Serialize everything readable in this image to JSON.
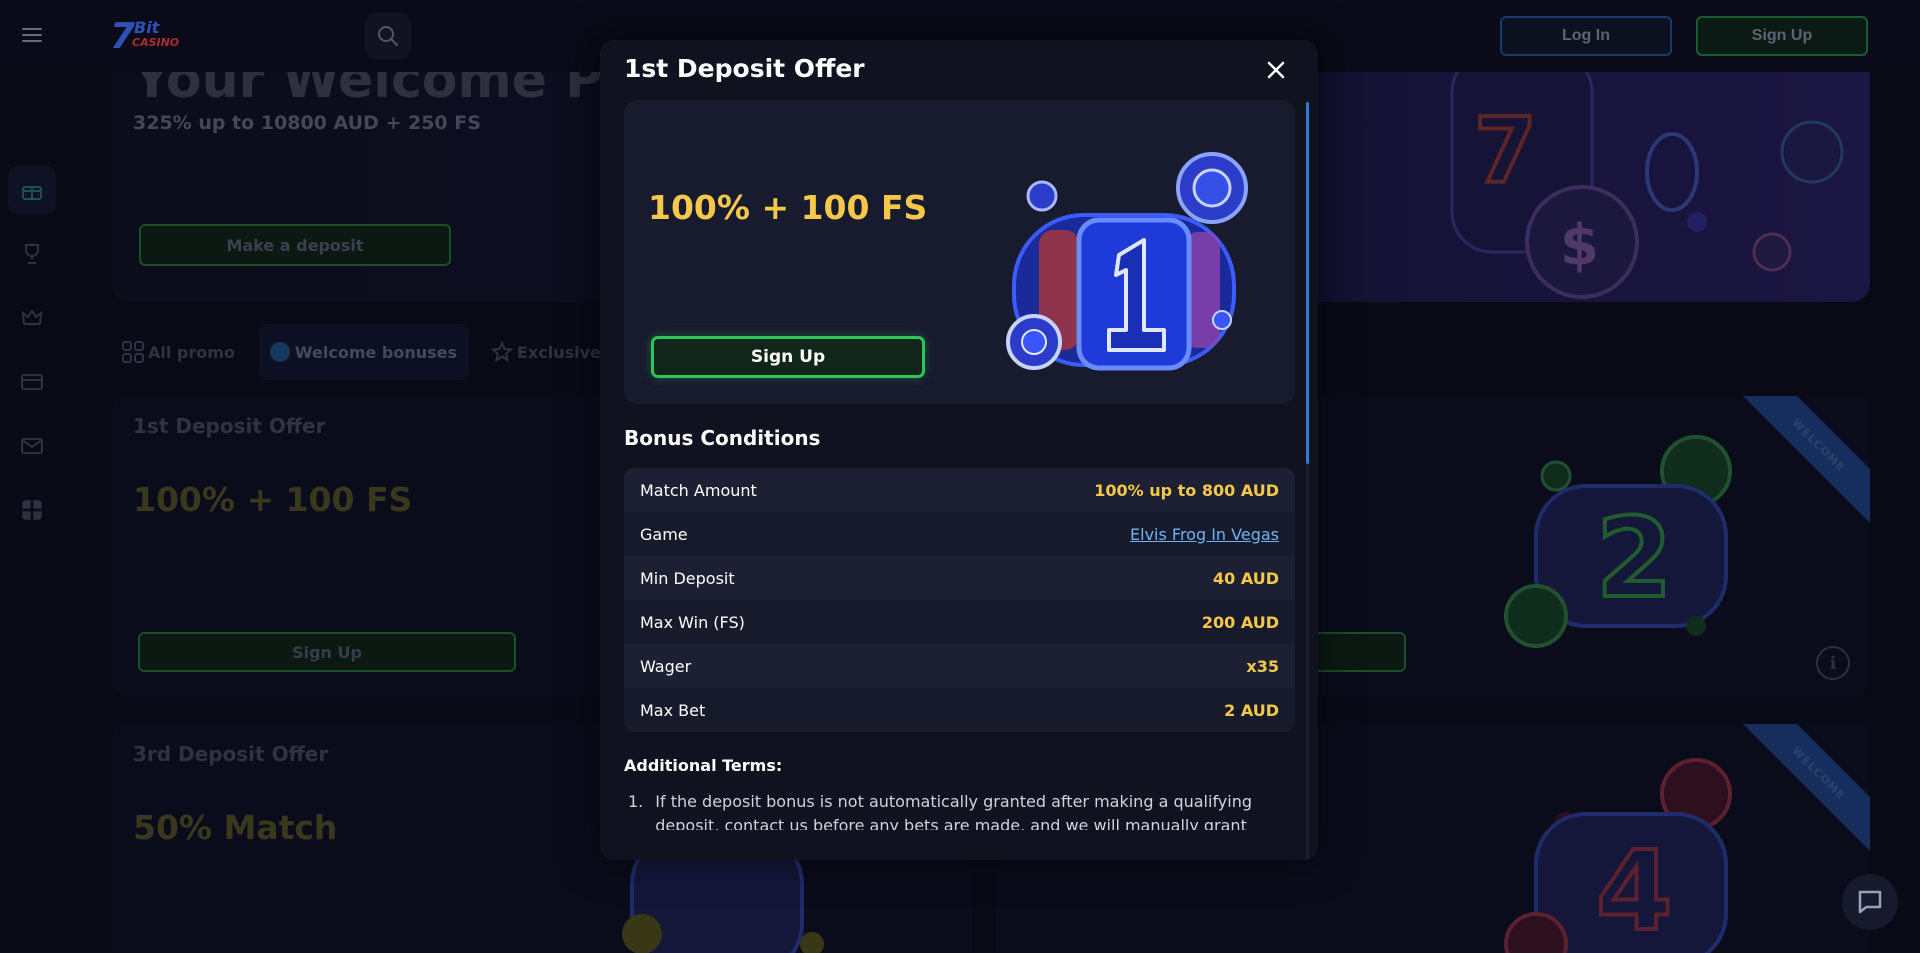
{
  "header": {
    "login_label": "Log In",
    "signup_label": "Sign Up",
    "logo": {
      "main": "7",
      "bit": "Bit",
      "casino": "CASINO"
    }
  },
  "hero": {
    "title": "Your Welcome Package",
    "subtitle": "325% up to 10800 AUD + 250 FS",
    "button_label": "Make a deposit"
  },
  "tabs": [
    {
      "label": "All promo"
    },
    {
      "label": "Welcome bonuses"
    },
    {
      "label": "Exclusive"
    }
  ],
  "cards": [
    {
      "title": "1st Deposit Offer",
      "value": "100% + 100 FS",
      "button_label": "Sign Up"
    },
    {
      "title": "3rd Deposit Offer",
      "value": "50% Match"
    },
    {
      "ribbon": "WELCOME"
    },
    {
      "ribbon": "WELCOME"
    }
  ],
  "modal": {
    "title": "1st Deposit Offer",
    "offer_value": "100% + 100 FS",
    "signup_label": "Sign Up",
    "conditions_title": "Bonus Conditions",
    "conditions": [
      {
        "label": "Match Amount",
        "value": "100% up to 800 AUD"
      },
      {
        "label": "Game",
        "value": "Elvis Frog In Vegas"
      },
      {
        "label": "Min Deposit",
        "value": "40 AUD"
      },
      {
        "label": "Max Win (FS)",
        "value": "200 AUD"
      },
      {
        "label": "Wager",
        "value": "x35"
      },
      {
        "label": "Max Bet",
        "value": "2 AUD"
      }
    ],
    "terms_title": "Additional Terms:",
    "terms": [
      {
        "num": "1.",
        "text": "If the deposit bonus is not automatically granted after making a qualifying deposit, contact us before any bets are made, and we will manually grant you"
      }
    ]
  },
  "colors": {
    "accent_green": "#2cc55a",
    "highlight_yellow": "#f5c84a",
    "link_blue": "#6db3f5",
    "scroll_blue": "#2f7bd9"
  },
  "icons": [
    "menu-icon",
    "search-icon",
    "gift-icon",
    "trophy-icon",
    "crown-icon",
    "card-icon",
    "mail-icon",
    "gift-box-icon",
    "close-icon",
    "info-icon",
    "chat-icon"
  ]
}
